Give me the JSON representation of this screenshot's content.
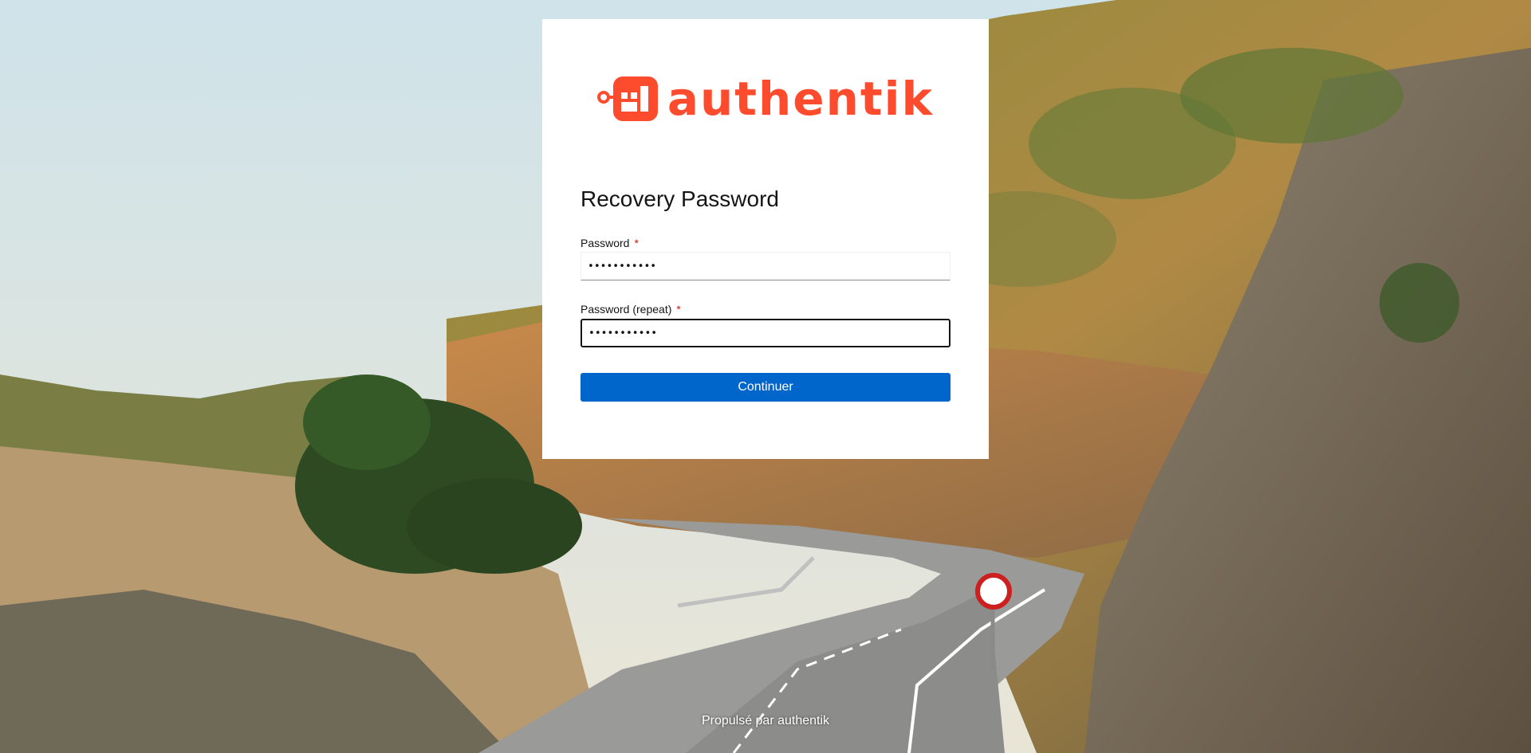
{
  "brand": {
    "name": "authentik",
    "icon": "authentik-logo-icon",
    "color": "#fd4b2d"
  },
  "form": {
    "title": "Recovery Password",
    "password": {
      "label": "Password",
      "required_marker": "*",
      "value": "•••••••••••"
    },
    "password_repeat": {
      "label": "Password (repeat)",
      "required_marker": "*",
      "value": "•••••••••••"
    },
    "submit_label": "Continuer"
  },
  "footer": {
    "text": "Propulsé par authentik"
  },
  "colors": {
    "primary_button": "#0066cc",
    "required": "#c9190b"
  }
}
